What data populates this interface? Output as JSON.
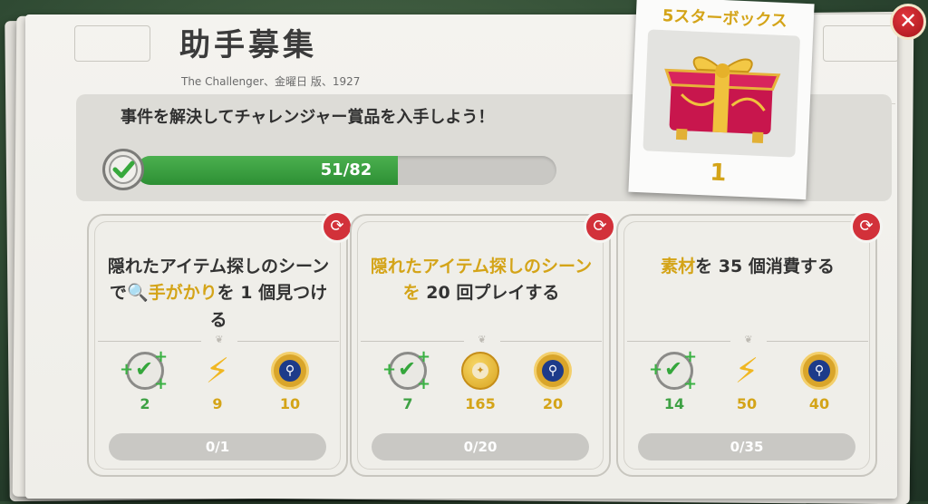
{
  "header": {
    "title": "助手募集",
    "subtitle": "The Challenger、金曜日 版、1927"
  },
  "objective": {
    "text": "事件を解決してチャレンジャー賞品を入手しよう！",
    "progress_text": "51/82",
    "progress_fraction": 0.622
  },
  "reward": {
    "title": "5スターボックス",
    "count": "1",
    "icon": "gift-box-icon"
  },
  "tasks": [
    {
      "text_parts": [
        "隠れたアイテム探しのシーンで",
        "手がかり",
        "を 1 個見つける"
      ],
      "rewards": [
        {
          "icon": "check-plus-icon",
          "value": "2"
        },
        {
          "icon": "lightning-icon",
          "value": "9"
        },
        {
          "icon": "magnifier-medal-icon",
          "value": "10"
        }
      ],
      "progress": "0/1"
    },
    {
      "text_parts": [
        "隠れたアイテム探しのシーンを",
        " 20 回プレイする"
      ],
      "rewards": [
        {
          "icon": "check-plus-icon",
          "value": "7"
        },
        {
          "icon": "coin-icon",
          "value": "165"
        },
        {
          "icon": "magnifier-medal-icon",
          "value": "20"
        }
      ],
      "progress": "0/20"
    },
    {
      "text_parts": [
        "素材",
        "を 35 個消費する"
      ],
      "rewards": [
        {
          "icon": "check-plus-icon",
          "value": "14"
        },
        {
          "icon": "lightning-icon",
          "value": "50"
        },
        {
          "icon": "magnifier-medal-icon",
          "value": "40"
        }
      ],
      "progress": "0/35"
    }
  ]
}
